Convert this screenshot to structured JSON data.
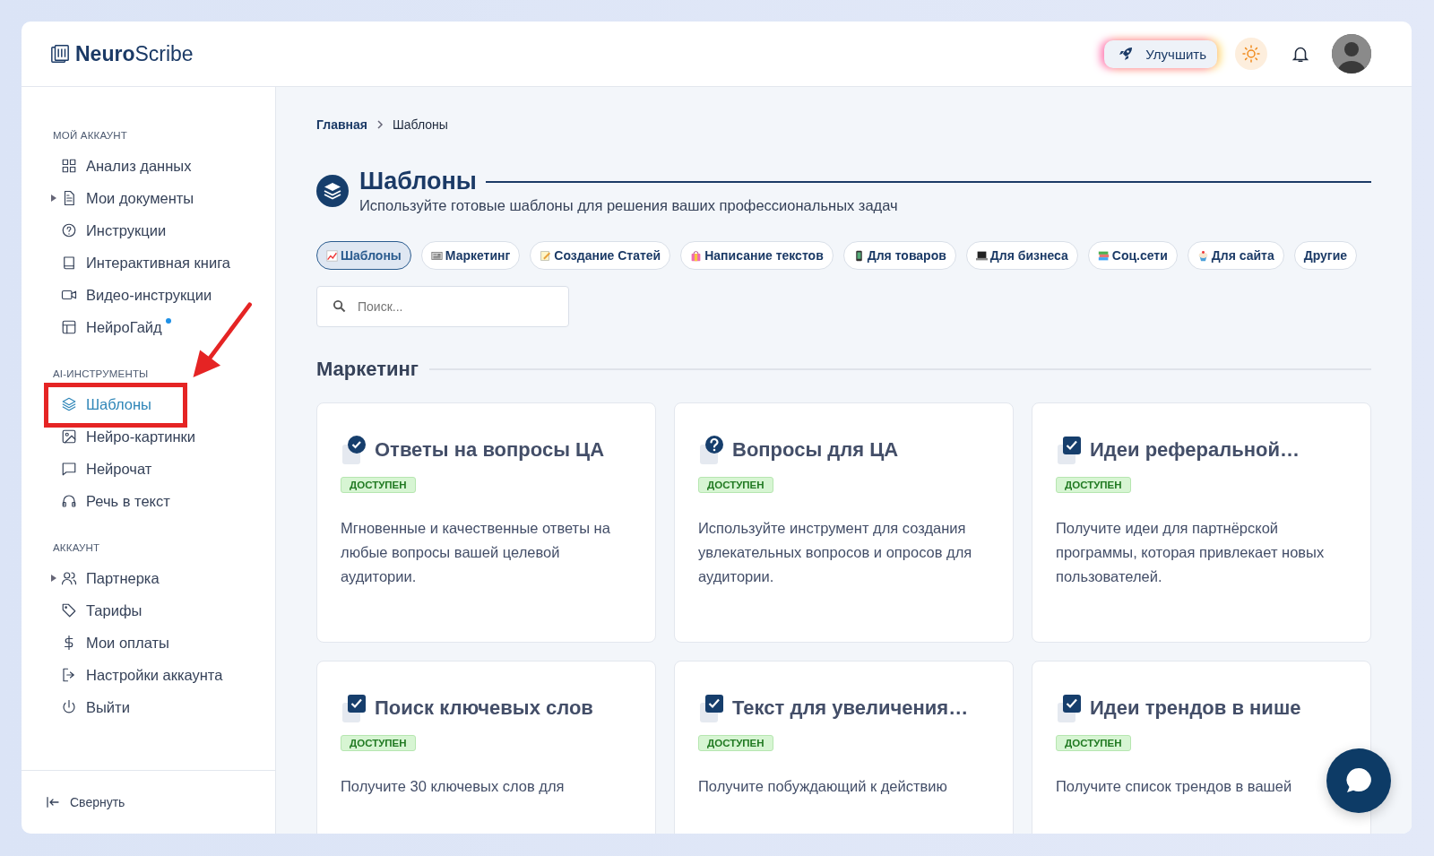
{
  "header": {
    "logo": "**Neuro**Scribe",
    "upgrade_button": "Улучшить"
  },
  "sidebar": {
    "sections": [
      {
        "title": "МОЙ АККАУНТ",
        "items": [
          {
            "label": "Анализ данных",
            "selected": false
          },
          {
            "label": "Мои документы",
            "selected": false,
            "expanded": false
          },
          {
            "label": "Инструкции",
            "selected": false
          },
          {
            "label": "Интерактивная книга",
            "selected": false
          },
          {
            "label": "Видео-инструкции",
            "selected": false
          },
          {
            "label": "НейроГайд",
            "selected": false,
            "unread": true
          }
        ]
      },
      {
        "title": "AI-ИНСТРУМЕНТЫ",
        "items": [
          {
            "label": "Шаблоны",
            "selected": true
          },
          {
            "label": "Нейро-картинки",
            "selected": false
          },
          {
            "label": "Нейрочат",
            "selected": false
          },
          {
            "label": "Речь в текст",
            "selected": false
          }
        ]
      },
      {
        "title": "АККАУНТ",
        "items": [
          {
            "label": "Партнерка",
            "selected": false,
            "expanded": false
          },
          {
            "label": "Тарифы",
            "selected": false
          },
          {
            "label": "Мои оплаты",
            "selected": false
          },
          {
            "label": "Настройки аккаунта",
            "selected": false
          },
          {
            "label": "Выйти",
            "selected": false
          }
        ]
      }
    ],
    "collapse": "Свернуть"
  },
  "breadcrumbs": [
    "Главная",
    "Шаблоны"
  ],
  "page": {
    "title": "Шаблоны",
    "subtitle": "Используйте готовые шаблоны для решения ваших профессиональных задач"
  },
  "chips": [
    {
      "label": "Шаблоны",
      "selected": true
    },
    {
      "label": "Маркетинг",
      "selected": false
    },
    {
      "label": "Создание Статей",
      "selected": false
    },
    {
      "label": "Написание текстов",
      "selected": false
    },
    {
      "label": "Для товаров",
      "selected": false
    },
    {
      "label": "Для бизнеса",
      "selected": false
    },
    {
      "label": "Соц.сети",
      "selected": false
    },
    {
      "label": "Для сайта",
      "selected": false
    },
    {
      "label": "Другие",
      "selected": false
    }
  ],
  "search": {
    "placeholder": "Поиск..."
  },
  "section_title": "Маркетинг",
  "cards": [
    {
      "kind": "check",
      "title": "Ответы на вопросы ЦА",
      "badge": "ДОСТУПЕН",
      "description": "Мгновенные и качественные ответы на любые вопросы вашей целевой аудитории."
    },
    {
      "kind": "question",
      "title": "Вопросы для ЦА",
      "badge": "ДОСТУПЕН",
      "description": "Используйте инструмент для создания увлекательных вопросов и опросов для аудитории."
    },
    {
      "kind": "checkbox",
      "title": "Идеи реферальной…",
      "badge": "ДОСТУПЕН",
      "description": "Получите идеи для партнёрской программы, которая привлекает новых пользователей."
    },
    {
      "kind": "checkbox",
      "title": "Поиск ключевых слов",
      "badge": "ДОСТУПЕН",
      "description": "Получите 30 ключевых слов для"
    },
    {
      "kind": "checkbox",
      "title": "Текст для увеличения…",
      "badge": "ДОСТУПЕН",
      "description": "Получите побуждающий к действию"
    },
    {
      "kind": "checkbox",
      "title": "Идеи трендов в нише",
      "badge": "ДОСТУПЕН",
      "description": "Получите список трендов в вашей"
    }
  ]
}
